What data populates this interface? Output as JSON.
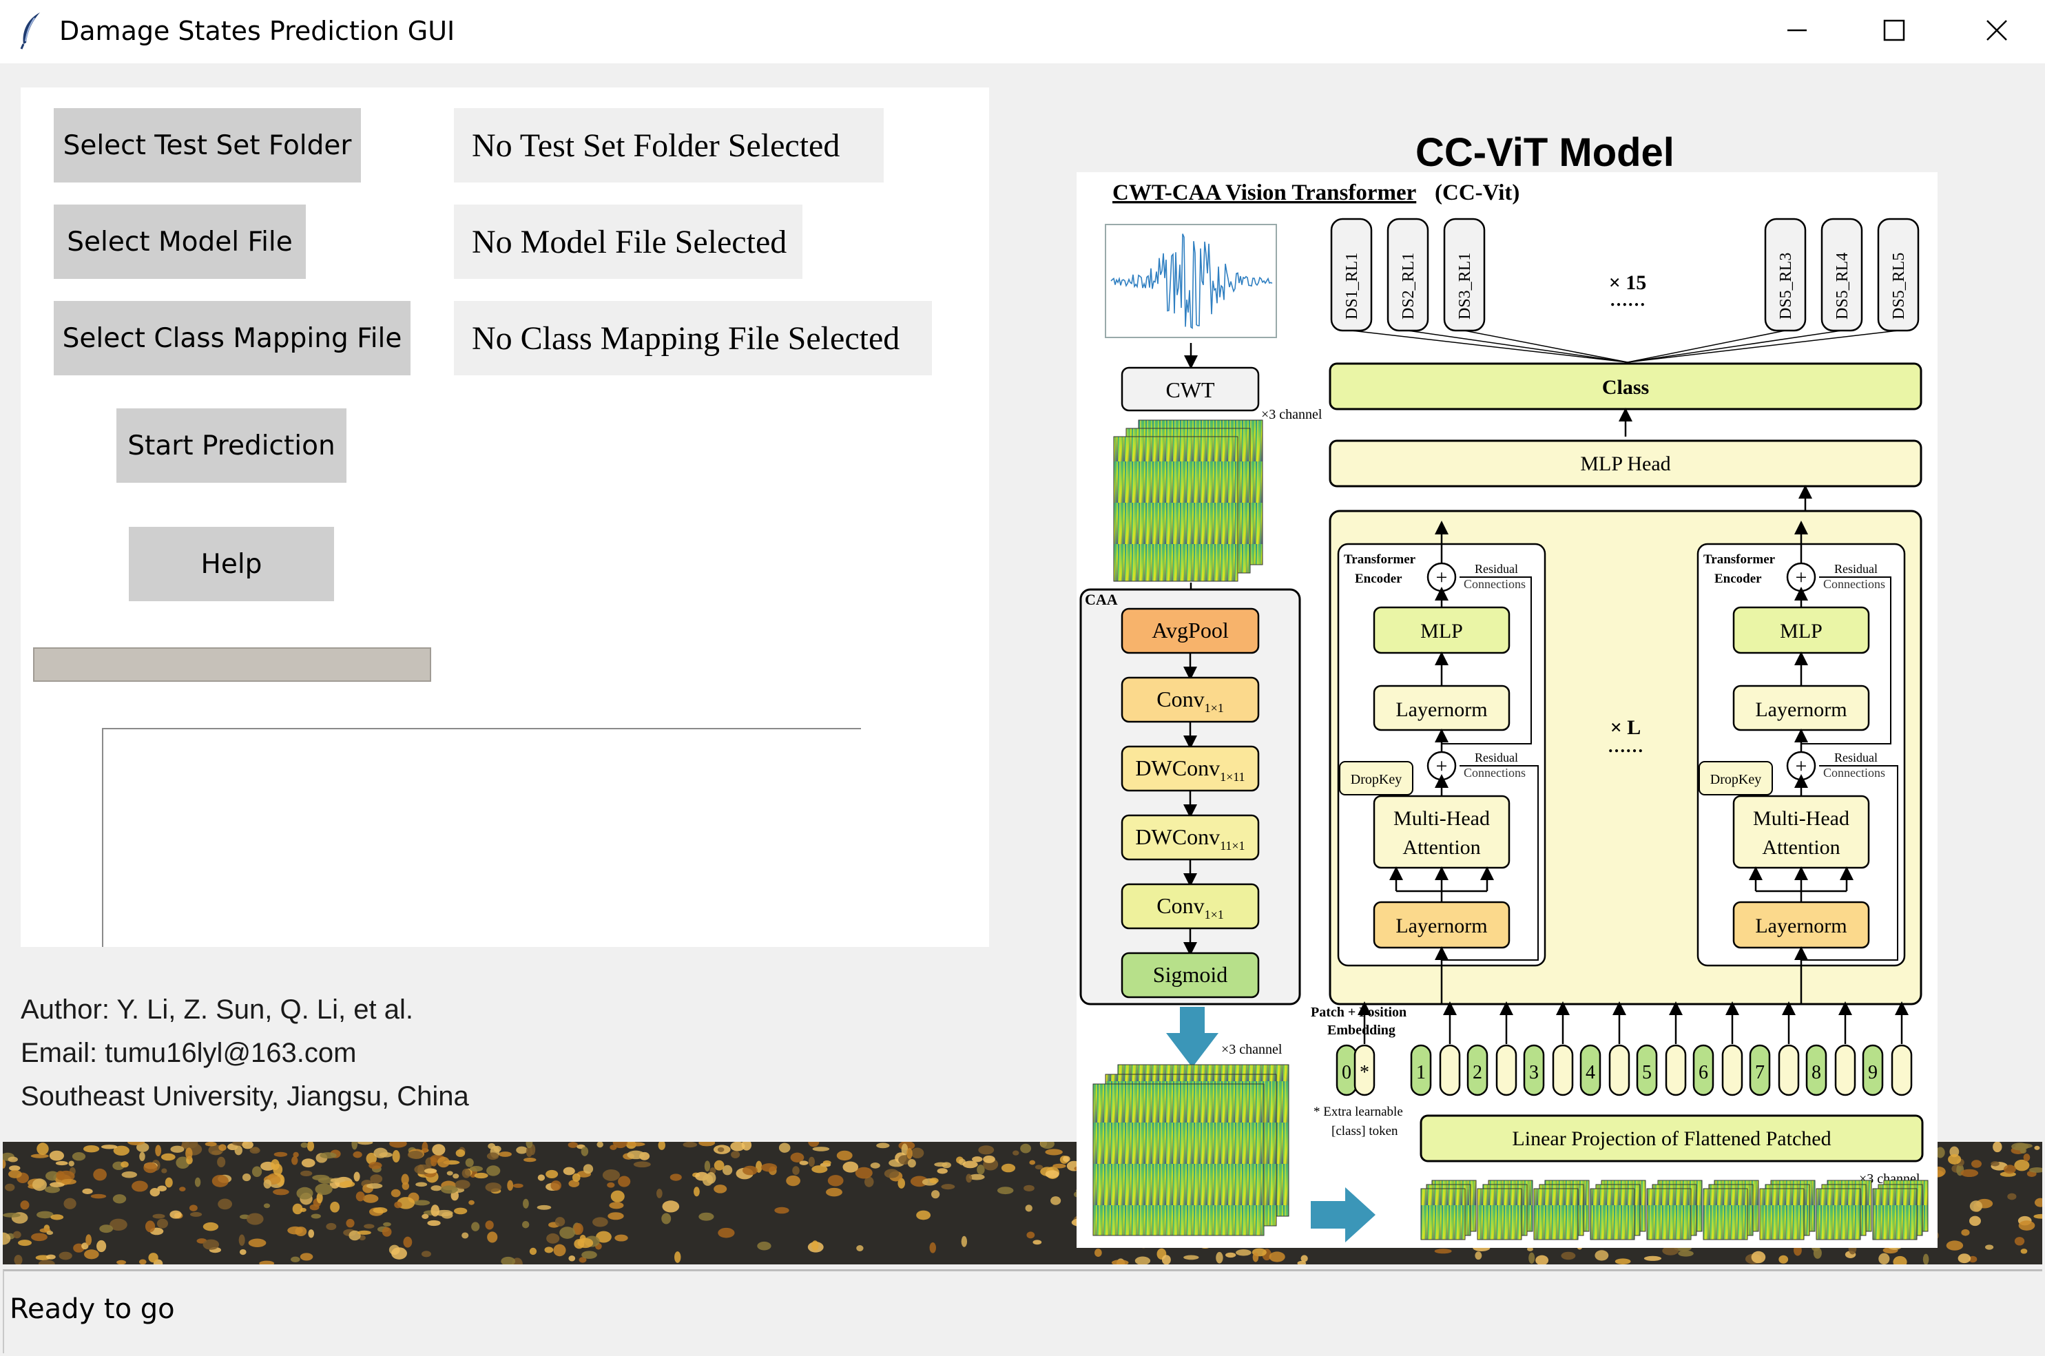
{
  "window": {
    "title": "Damage States Prediction GUI",
    "controls": {
      "minimize_glyph": "─",
      "maximize_glyph": "☐",
      "close_glyph": "✕"
    }
  },
  "controls": {
    "select_test_set_button": "Select Test Set Folder",
    "select_model_button": "Select Model File",
    "select_mapping_button": "Select Class Mapping File",
    "start_prediction_button": "Start Prediction",
    "help_button": "Help"
  },
  "labels": {
    "test_set": "No Test Set Folder Selected",
    "model_file": "No Model File Selected",
    "mapping_file": "No Class Mapping File Selected"
  },
  "progress": {
    "fraction": 0
  },
  "result_box": {
    "value": ""
  },
  "info": {
    "author": "Author: Y. Li, Z. Sun, Q. Li, et al.",
    "email": "Email: tumu16lyl@163.com",
    "affiliation": "Southeast University, Jiangsu, China"
  },
  "status": {
    "text": "Ready to go"
  },
  "model_image": {
    "heading": "CC-ViT Model",
    "figure_title_underlined": "CWT-CAA Vision Transformer",
    "figure_title_suffix": "(CC-Vit)",
    "outputs": [
      "DS1_RL1",
      "DS2_RL1",
      "DS3_RL1",
      "DS5_RL3",
      "DS5_RL4",
      "DS5_RL5"
    ],
    "repeat_x15": "× 15",
    "repeat_xL": "× L",
    "dots": "……",
    "cwt": "CWT",
    "channel_note": "×3 channel",
    "caa": "CAA",
    "caa_blocks": [
      {
        "text": "AvgPool",
        "sub": "",
        "color": "#f7b36b"
      },
      {
        "text": "Conv",
        "sub": "1×1",
        "color": "#fbd98c"
      },
      {
        "text": "DWConv",
        "sub": "1×11",
        "color": "#fbe79a"
      },
      {
        "text": "DWConv",
        "sub": "11×1",
        "color": "#f6f0a4"
      },
      {
        "text": "Conv",
        "sub": "1×1",
        "color": "#eef19c"
      },
      {
        "text": "Sigmoid",
        "sub": "",
        "color": "#b7e08a"
      }
    ],
    "class_label": "Class",
    "mlp_head": "MLP Head",
    "encoder_label_1": "Transformer",
    "encoder_label_2": "Encoder",
    "residual_1": "Residual",
    "residual_2": "Connections",
    "plus": "+",
    "mlp": "MLP",
    "layernorm": "Layernorm",
    "dropkey": "DropKey",
    "mha_1": "Multi-Head",
    "mha_2": "Attention",
    "patch_pos_1": "Patch + Position",
    "patch_pos_2": "Embedding",
    "tokens": [
      "0",
      "*",
      "1",
      "2",
      "3",
      "4",
      "5",
      "6",
      "7",
      "8",
      "9"
    ],
    "extra_token_1": "* Extra learnable",
    "extra_token_2": "[class] token",
    "linear_projection": "Linear Projection of Flattened Patched",
    "colors": {
      "yellow_green": "#eaf5a6",
      "light_yellow": "#fbf8cf",
      "orange": "#f7b36b",
      "gold": "#fbd98c",
      "arrow_blue": "#3b96b8",
      "viridis_dark": "#3b528b",
      "viridis_teal": "#21918c",
      "viridis_green": "#5ec962",
      "viridis_yellow": "#fde725"
    }
  }
}
